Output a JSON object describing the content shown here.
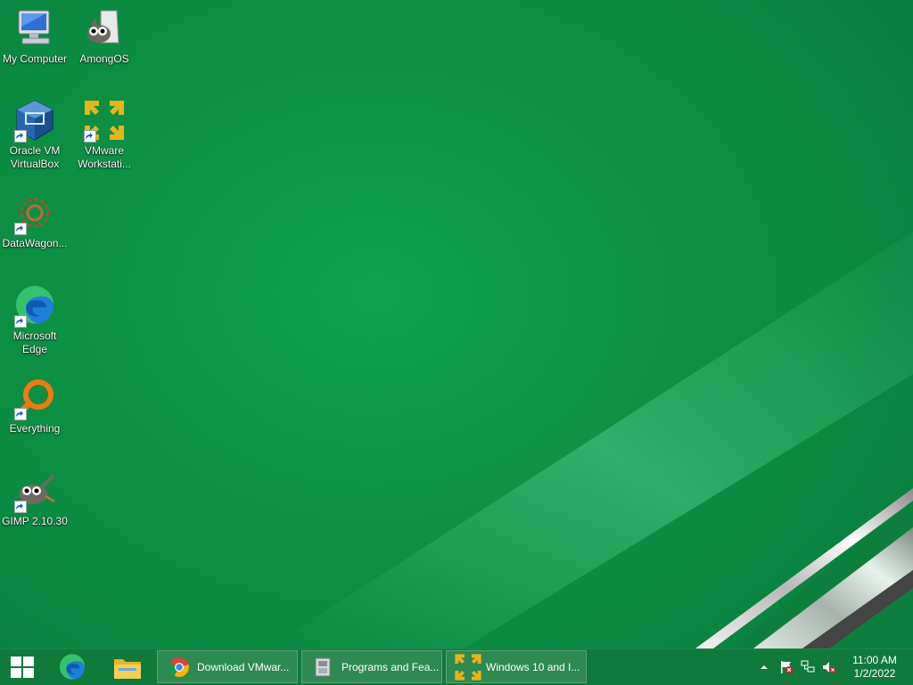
{
  "desktop": {
    "icons": [
      {
        "label": "My Computer",
        "icon": "my-computer-icon",
        "shortcut": false
      },
      {
        "label": "AmongOS",
        "icon": "gimp-wilber-icon",
        "shortcut": false
      },
      {
        "label": "Oracle VM VirtualBox",
        "icon": "virtualbox-icon",
        "shortcut": true
      },
      {
        "label": "VMware Workstati...",
        "icon": "vmware-icon",
        "shortcut": true
      },
      {
        "label": "DataWagon...",
        "icon": "datawagon-gear-icon",
        "shortcut": true
      },
      {
        "label": "Microsoft Edge",
        "icon": "edge-icon",
        "shortcut": true
      },
      {
        "label": "Everything",
        "icon": "everything-search-icon",
        "shortcut": true
      },
      {
        "label": "GIMP 2.10.30",
        "icon": "gimp-icon",
        "shortcut": true
      }
    ]
  },
  "taskbar": {
    "start_icon": "windows-start-icon",
    "pinned": [
      {
        "name": "edge-icon"
      },
      {
        "name": "file-explorer-icon"
      }
    ],
    "windows": [
      {
        "label": "Download VMwar...",
        "icon": "chrome-icon"
      },
      {
        "label": "Programs and Fea...",
        "icon": "control-panel-icon"
      },
      {
        "label": "Windows 10 and I...",
        "icon": "vmware-icon"
      }
    ],
    "tray": {
      "overflow_icon": "chevron-up-icon",
      "icons": [
        "action-center-flag-icon",
        "network-icon",
        "volume-muted-icon"
      ]
    },
    "clock": {
      "time": "11:00 AM",
      "date": "1/2/2022"
    }
  },
  "colors": {
    "wallpaper": "#0c8f43",
    "taskbar": "#10783a",
    "vmware_yellow": "#e8b418",
    "edge_blue": "#1f7fd8"
  }
}
